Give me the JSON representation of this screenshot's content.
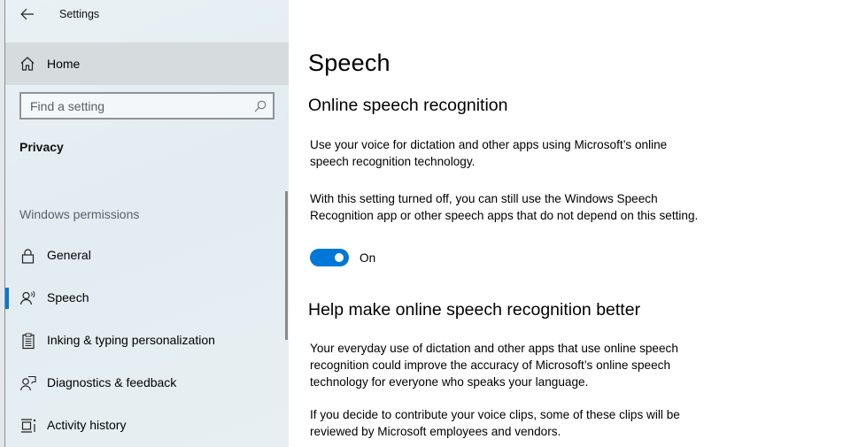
{
  "window": {
    "title": "Settings"
  },
  "sidebar": {
    "home_label": "Home",
    "search": {
      "placeholder": "Find a setting",
      "value": ""
    },
    "section_title": "Privacy",
    "group_label": "Windows permissions",
    "items": [
      {
        "label": "General",
        "icon": "lock-icon",
        "selected": false
      },
      {
        "label": "Speech",
        "icon": "speech-icon",
        "selected": true
      },
      {
        "label": "Inking & typing personalization",
        "icon": "clipboard-icon",
        "selected": false
      },
      {
        "label": "Diagnostics & feedback",
        "icon": "feedback-icon",
        "selected": false
      },
      {
        "label": "Activity history",
        "icon": "timeline-icon",
        "selected": false
      }
    ]
  },
  "main": {
    "page_title": "Speech",
    "section1": {
      "heading": "Online speech recognition",
      "para1": "Use your voice for dictation and other apps using Microsoft’s online speech recognition technology.",
      "para2": "With this setting turned off, you can still use the Windows Speech Recognition app or other speech apps that do not depend on this setting.",
      "toggle": {
        "state": "on",
        "label": "On"
      }
    },
    "section2": {
      "heading": "Help make online speech recognition better",
      "para1": "Your everyday use of dictation and other apps that use online speech recognition could improve the accuracy of Microsoft’s online speech technology for everyone who speaks your language.",
      "para2": "If you decide to contribute your voice clips, some of these clips will be reviewed by Microsoft employees and vendors."
    }
  },
  "colors": {
    "accent": "#0078d7",
    "sidebar_bg": "#e6eef2",
    "home_hover": "#d6dcde"
  }
}
